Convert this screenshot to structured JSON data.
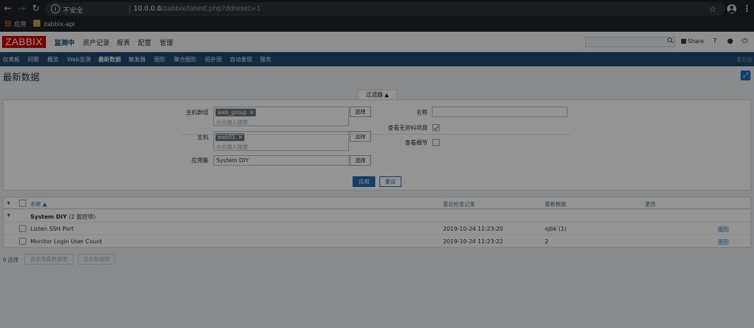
{
  "browser": {
    "insecure_label": "不安全",
    "url_host": "10.0.0.8",
    "url_path": "/zabbix/latest.php?ddreset=1",
    "bookmarks": [
      {
        "label": "应用",
        "icon": "apps-grid-icon"
      },
      {
        "label": "zabbix-api",
        "icon": "bookmark-favicon-icon"
      }
    ]
  },
  "header": {
    "logo": "ZABBIX",
    "menu": [
      "监测中",
      "资产记录",
      "报表",
      "配置",
      "管理"
    ],
    "active_menu": "监测中",
    "share_label": "Share",
    "help_label": "?"
  },
  "submenu": {
    "items": [
      "仪表板",
      "问题",
      "概览",
      "Web监测",
      "最新数据",
      "触发器",
      "图形",
      "聚合图形",
      "拓扑图",
      "自动发现",
      "服务"
    ],
    "active": "最新数据",
    "right_label": "著名版"
  },
  "page": {
    "title": "最新数据"
  },
  "filter": {
    "tab_label": "过滤器 ▲",
    "host_group_label": "主机群组",
    "host_group_tag": "web_group",
    "host_label": "主机",
    "host_tag": "web01",
    "placeholder": "在此输入搜索",
    "select_label": "选择",
    "application_label": "应用集",
    "application_value": "System DIY",
    "name_label": "名称",
    "name_value": "",
    "show_without_data_label": "查看无资料项目",
    "show_without_data": true,
    "show_details_label": "查看细节",
    "show_details": false,
    "apply_label": "应用",
    "reset_label": "重设"
  },
  "table": {
    "headers": {
      "name": "名称 ▲",
      "last_check": "最近检查记录",
      "last_value": "最新数据",
      "change": "更改"
    },
    "group_row": {
      "name": "System DIY",
      "count": "(2 监控项)"
    },
    "rows": [
      {
        "name": "Listen SSH Port",
        "last_check": "2019-10-24 11:23:20",
        "last_value": "ojbk (1)",
        "change": "",
        "action": "图形"
      },
      {
        "name": "Monitor Login User Count",
        "last_check": "2019-10-24 11:23:22",
        "last_value": "2",
        "change": "",
        "action": "图形"
      }
    ]
  },
  "footer": {
    "selected_count": "0 选择",
    "btn_stacked_graph": "显示堆叠数据图",
    "btn_graph": "显示数据图"
  }
}
